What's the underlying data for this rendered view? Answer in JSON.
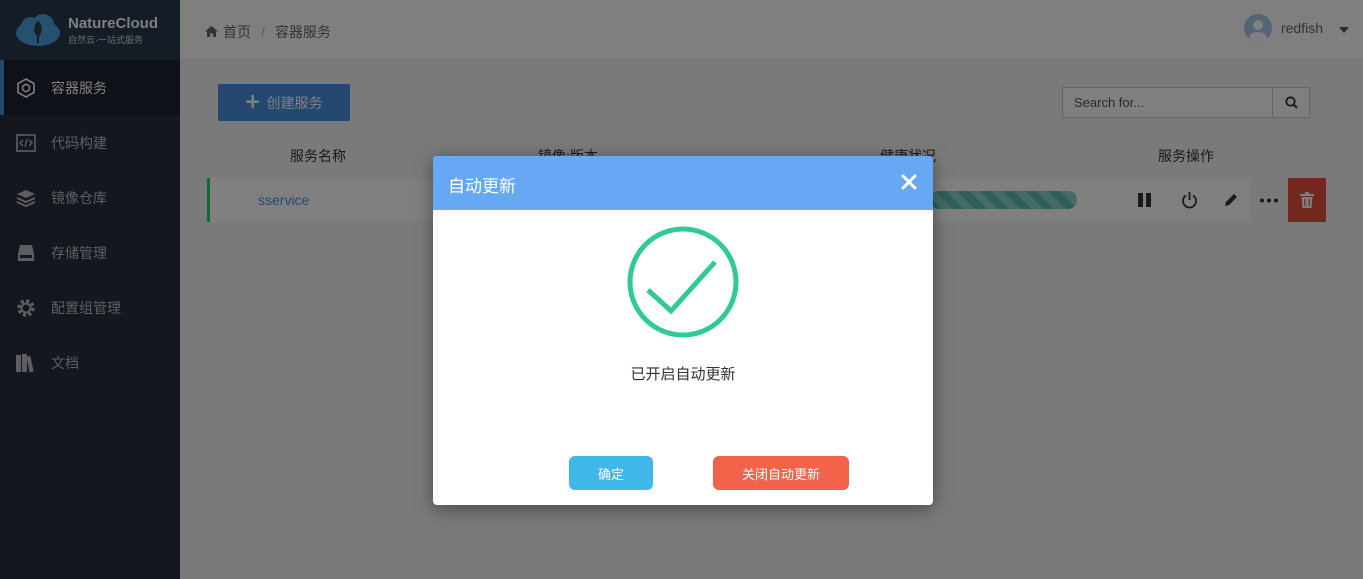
{
  "app": {
    "logo_title": "NatureCloud",
    "logo_subtitle": "自然云·一站式服务"
  },
  "sidebar": {
    "items": [
      {
        "label": "容器服务",
        "icon": "container-icon",
        "active": true
      },
      {
        "label": "代码构建",
        "icon": "code-icon",
        "active": false
      },
      {
        "label": "镜像仓库",
        "icon": "layers-icon",
        "active": false
      },
      {
        "label": "存储管理",
        "icon": "storage-icon",
        "active": false
      },
      {
        "label": "配置组管理",
        "icon": "gear-icon",
        "active": false
      },
      {
        "label": "文档",
        "icon": "books-icon",
        "active": false
      }
    ]
  },
  "header": {
    "breadcrumb": [
      "首页",
      "容器服务"
    ],
    "breadcrumb_sep": "/",
    "username": "redfish"
  },
  "toolbar": {
    "create_label": "创建服务",
    "search_placeholder": "Search for..."
  },
  "table": {
    "columns": [
      "服务名称",
      "镜像:版本",
      "健康状况",
      "服务操作"
    ],
    "rows": [
      {
        "name": "sservice"
      }
    ]
  },
  "modal": {
    "title": "自动更新",
    "message": "已开启自动更新",
    "ok_label": "确定",
    "disable_label": "关闭自动更新"
  },
  "colors": {
    "sidebar_bg": "#2b2e3c",
    "accent": "#4a90e2",
    "modal_header": "#66a8f4",
    "success": "#2ecc8f",
    "ok_button": "#3fb7e8",
    "danger_button": "#f2634a"
  }
}
